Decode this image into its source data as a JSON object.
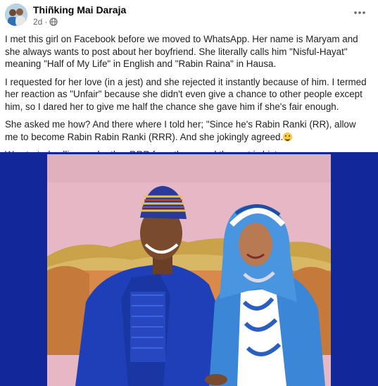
{
  "post": {
    "author": "Thiñking Mai Daraja",
    "time": "2d",
    "separator": "·",
    "privacy_icon": "globe-icon",
    "more_icon": "more-horizontal-icon",
    "paragraphs": [
      "I met this girl on Facebook before we moved to WhatsApp. Her name is Maryam and she always wants to post about her boyfriend. She literally calls him \"Nisful-Hayat\" meaning \"Half of My Life\" in English and \"Rabin Raina\" in Hausa.",
      "I requested for her love (in a jest) and she rejected it instantly because of him. I termed her reaction as \"Unfair\" because she didn't even give a chance to other people except him, so I dared her to give me half the chance she gave him if she's fair enough.",
      "She asked me how? And there where I told her; \"Since he's Rabin Ranki (RR), allow me to become Rabin Rabin Ranki (RRR). And she jokingly agreed.",
      "We started calling each other RRR from there, and the rest is history."
    ],
    "emoji_icon": "grinning-face-icon"
  },
  "colors": {
    "frame_blue": "#12279a",
    "wall_pink": "#e9b9c6",
    "agbada_blue": "#1f3fb8",
    "hijab_blue": "#3b86d6"
  }
}
